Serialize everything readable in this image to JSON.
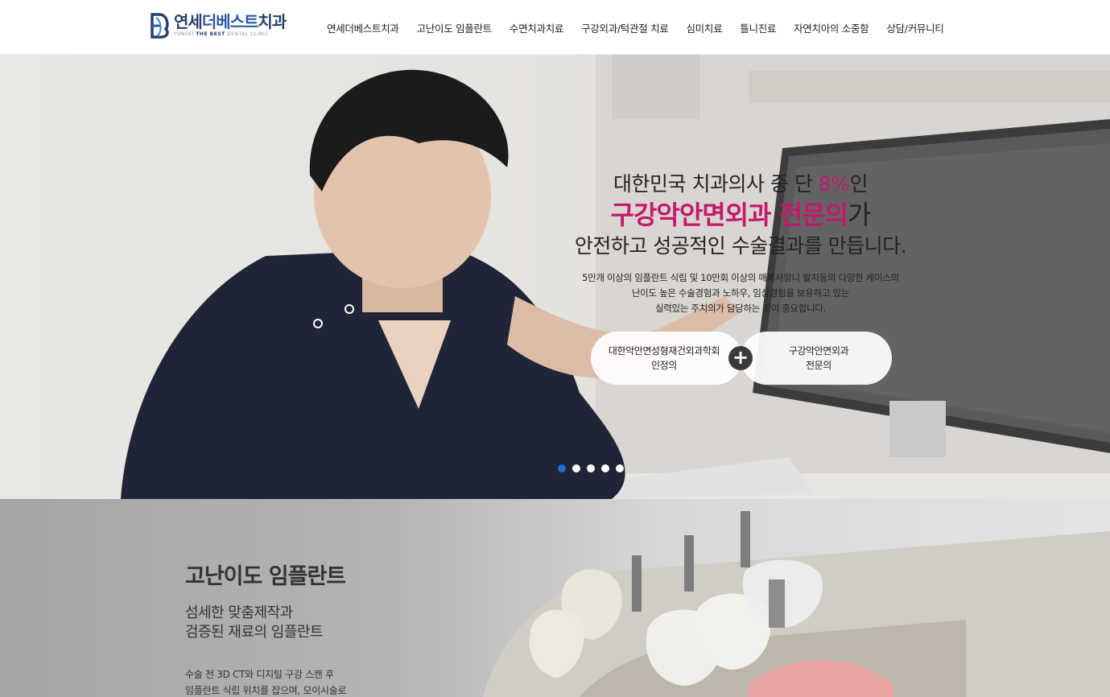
{
  "brand": {
    "name_a": "연세",
    "name_b": "더베스트",
    "name_c": "치과",
    "sub_a": "YONSEI ",
    "sub_b": "THE BEST",
    "sub_c": " DENTAL CLINIC",
    "color": "#27406b"
  },
  "nav": {
    "items": [
      "연세더베스트치과",
      "고난이도 임플란트",
      "수면치과치료",
      "구강외과/턱관절 치료",
      "심미치료",
      "틀니진료",
      "자연치아의 소중함",
      "상담/커뮤니티"
    ]
  },
  "hero": {
    "line1_a": "대한민국 치과의사 중 단 ",
    "line1_b": "8%",
    "line1_c": "인",
    "line2_a": "구강악안면외과 전문의",
    "line2_b": "가",
    "line3": "안전하고 성공적인 수술결과를 만듭니다.",
    "desc": [
      "5만개 이상의 임플란트 식립 및 10만회 이상의 매복사랑니 발치등의 다양한 케이스의",
      "난이도 높은 수술경험과 노하우, 임상경험을 보유하고 있는",
      "실력있는 주치의가 담당하는 것이 중요합니다."
    ],
    "badge_a": [
      "대한악안면성형재건외과학회",
      "인정의"
    ],
    "badge_b": [
      "구강악안면외과",
      "전문의"
    ],
    "plus_symbol": "+",
    "accent_color": "#c4186e",
    "slides": 5,
    "active_slide": 1,
    "dot_active_color": "#1f6fd1"
  },
  "implant": {
    "title": "고난이도 임플란트",
    "subtitle": [
      "섬세한 맞춤제작과",
      "검증된 재료의 임플란트"
    ],
    "desc": [
      "수술 전 3D CT와 디지털 구강 스캔 후",
      "임플란트 식립 위치를 잡으며, 모이시술로"
    ]
  }
}
